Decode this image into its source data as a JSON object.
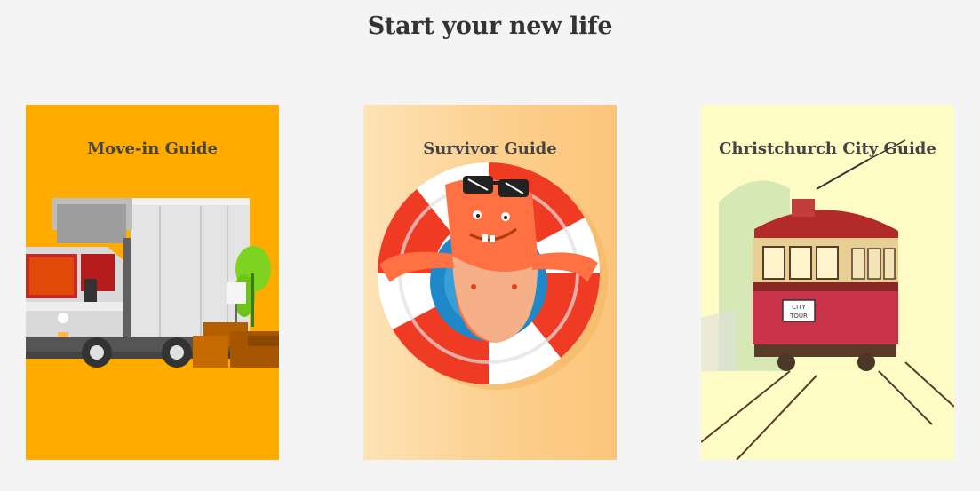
{
  "page": {
    "heading": "Start your new life"
  },
  "cards": [
    {
      "title": "Move-in Guide",
      "bg": "#ffab00",
      "illustration": "moving-truck-illustration"
    },
    {
      "title": "Survivor Guide",
      "bg": "#fcd08f",
      "illustration": "life-ring-character-illustration"
    },
    {
      "title": "Christchurch City Guide",
      "bg": "#fefbc4",
      "illustration": "tram-sketch-illustration",
      "tram_sign": "CITY TOUR"
    }
  ]
}
